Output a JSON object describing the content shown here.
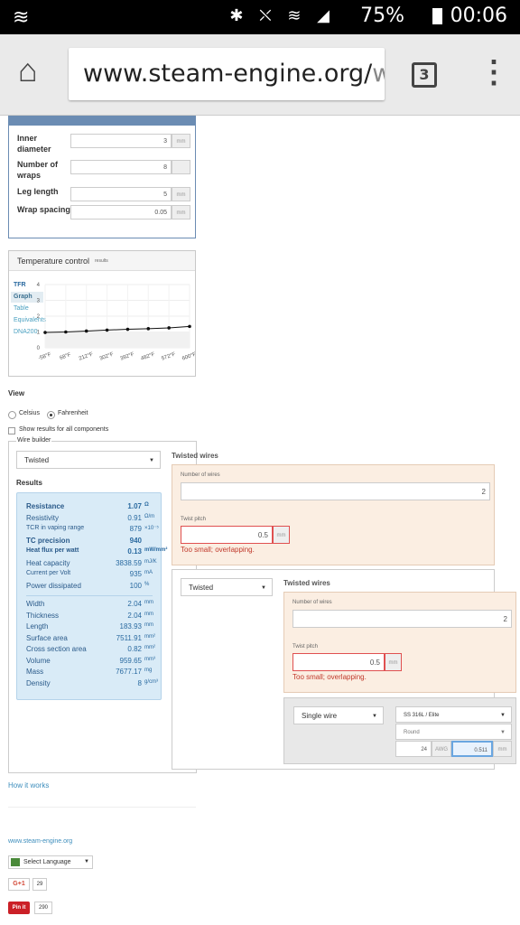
{
  "status": {
    "time": "00:06",
    "battery": "75%",
    "icons": "✱ ⛌ ≋ ◢"
  },
  "browser": {
    "url_main": "www.steam-engine.org/",
    "url_rest": "w",
    "tab_count": "3",
    "home": "⌂",
    "menu": "⋮"
  },
  "coil": {
    "rows": [
      {
        "label": "Inner diameter",
        "value": "3",
        "unit": "mm"
      },
      {
        "label": "Number of wraps",
        "value": "8",
        "unit": ""
      },
      {
        "label": "Leg length",
        "value": "5",
        "unit": "mm"
      },
      {
        "label": "Wrap spacing",
        "value": "0.05",
        "unit": "mm"
      }
    ]
  },
  "temp": {
    "title": "Temperature control",
    "title_small": "results",
    "menu": [
      "TFR",
      "Graph",
      "Table",
      "Equivalents",
      "DNA200"
    ],
    "y_ticks": [
      "4",
      "3",
      "2",
      "1",
      "0"
    ],
    "x_ticks": [
      "-58°F",
      "68°F",
      "212°F",
      "302°F",
      "392°F",
      "482°F",
      "572°F",
      "600°F"
    ]
  },
  "chart_data": {
    "type": "line",
    "categories": [
      "-58°F",
      "68°F",
      "212°F",
      "302°F",
      "392°F",
      "482°F",
      "572°F",
      "600°F"
    ],
    "values": [
      0.97,
      1.0,
      1.06,
      1.12,
      1.17,
      1.21,
      1.26,
      1.35
    ],
    "ylim": [
      0,
      4
    ]
  },
  "view": {
    "title": "View",
    "celsius": "Celsius",
    "fahrenheit": "Fahrenheit",
    "show_all": "Show results for all components",
    "builder": "Wire builder"
  },
  "builder": {
    "type1": "Twisted",
    "results_title": "Results",
    "twisted_title": "Twisted wires",
    "num_wires_label": "Number of wires",
    "num_wires": "2",
    "twist_pitch_label": "Twist pitch",
    "twist_pitch": "0.5",
    "mm": "mm",
    "warn": "Too small; overlapping.",
    "type2": "Twisted",
    "twisted_title2": "Twisted wires",
    "num_wires_label2": "Number of wires",
    "num_wires2": "2",
    "twist_pitch_label2": "Twist pitch",
    "twist_pitch2": "0.5",
    "warn2": "Too small; overlapping.",
    "single": "Single wire",
    "material": "SS 316L / Elite",
    "shape": "Round",
    "gauge": "24",
    "awg": "AWG",
    "diameter": "0.511",
    "mm2": "mm"
  },
  "results": [
    {
      "k": "Resistance",
      "v": "1.07",
      "u": "Ω",
      "b": true
    },
    {
      "k": "Resistivity",
      "v": "0.91",
      "u": "Ω/m",
      "b": false
    },
    {
      "k": "TCR in vaping range",
      "v": "879",
      "u": "×10⁻⁵",
      "b": false
    },
    {
      "k": "TC precision",
      "v": "940",
      "u": "",
      "b": true
    },
    {
      "k": "Heat flux per watt",
      "v": "0.13",
      "u": "mW/mm²",
      "b": true
    },
    {
      "k": "Heat capacity",
      "v": "3838.59",
      "u": "mJ/K",
      "b": false
    },
    {
      "k": "Current per Volt",
      "v": "935",
      "u": "mA",
      "b": false
    },
    {
      "k": "Power dissipated",
      "v": "100",
      "u": "%",
      "b": false
    },
    {
      "k": "",
      "v": "",
      "u": "",
      "b": false
    },
    {
      "k": "Width",
      "v": "2.04",
      "u": "mm",
      "b": false
    },
    {
      "k": "Thickness",
      "v": "2.04",
      "u": "mm",
      "b": false
    },
    {
      "k": "Length",
      "v": "183.93",
      "u": "mm",
      "b": false
    },
    {
      "k": "Surface area",
      "v": "7511.91",
      "u": "mm²",
      "b": false
    },
    {
      "k": "Cross section area",
      "v": "0.82",
      "u": "mm²",
      "b": false
    },
    {
      "k": "Volume",
      "v": "959.65",
      "u": "mm³",
      "b": false
    },
    {
      "k": "Mass",
      "v": "7677.17",
      "u": "mg",
      "b": false
    },
    {
      "k": "Density",
      "v": "8",
      "u": "g/cm³",
      "b": false
    }
  ],
  "footer": {
    "how": "How it works",
    "site": "www.steam-engine.org",
    "lang": "Select Language",
    "gplus": "G+1",
    "gcount": "29",
    "pin": "Pin it",
    "pcount": "290"
  }
}
